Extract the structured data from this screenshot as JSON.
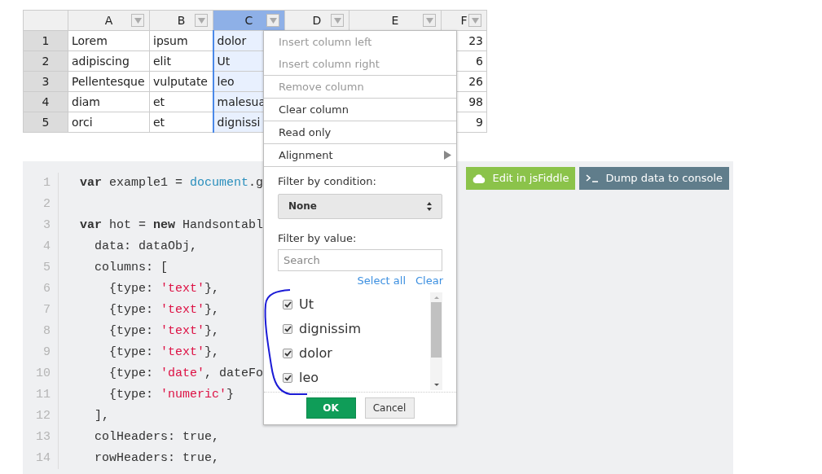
{
  "table": {
    "columns": [
      {
        "label": "A",
        "selected": false
      },
      {
        "label": "B",
        "selected": false
      },
      {
        "label": "C",
        "selected": true
      },
      {
        "label": "D",
        "selected": false
      },
      {
        "label": "E",
        "selected": false
      },
      {
        "label": "F",
        "selected": false
      }
    ],
    "rows": [
      {
        "header": "1",
        "a": "Lorem",
        "b": "ipsum",
        "c": "dolor",
        "f": "23"
      },
      {
        "header": "2",
        "a": "adipiscing",
        "b": "elit",
        "c": "Ut",
        "f": "6"
      },
      {
        "header": "3",
        "a": "Pellentesque",
        "b": "vulputate",
        "c": "leo",
        "f": "26"
      },
      {
        "header": "4",
        "a": "diam",
        "b": "et",
        "c": "malesua",
        "f": "98"
      },
      {
        "header": "5",
        "a": "orci",
        "b": "et",
        "c": "dignissi",
        "f": "9"
      }
    ]
  },
  "code": {
    "lines": [
      {
        "number": "1",
        "tokens": [
          {
            "kind": "keyword",
            "text": "var"
          },
          {
            "kind": "plain",
            "text": " example1 = "
          },
          {
            "kind": "property",
            "text": "document"
          },
          {
            "kind": "plain",
            "text": ".g"
          }
        ]
      },
      {
        "number": "2"
      },
      {
        "number": "3",
        "tokens": [
          {
            "kind": "keyword",
            "text": "var"
          },
          {
            "kind": "plain",
            "text": " hot = "
          },
          {
            "kind": "keyword",
            "text": "new"
          },
          {
            "kind": "plain",
            "text": " Handsontabl"
          }
        ]
      },
      {
        "number": "4",
        "tokens": [
          {
            "kind": "plain",
            "text": "  data: dataObj,"
          }
        ]
      },
      {
        "number": "5",
        "tokens": [
          {
            "kind": "plain",
            "text": "  columns: ["
          }
        ]
      },
      {
        "number": "6",
        "tokens": [
          {
            "kind": "plain",
            "text": "    {type: "
          },
          {
            "kind": "string",
            "text": "'text'"
          },
          {
            "kind": "plain",
            "text": "},"
          }
        ]
      },
      {
        "number": "7",
        "tokens": [
          {
            "kind": "plain",
            "text": "    {type: "
          },
          {
            "kind": "string",
            "text": "'text'"
          },
          {
            "kind": "plain",
            "text": "},"
          }
        ]
      },
      {
        "number": "8",
        "tokens": [
          {
            "kind": "plain",
            "text": "    {type: "
          },
          {
            "kind": "string",
            "text": "'text'"
          },
          {
            "kind": "plain",
            "text": "},"
          }
        ]
      },
      {
        "number": "9",
        "tokens": [
          {
            "kind": "plain",
            "text": "    {type: "
          },
          {
            "kind": "string",
            "text": "'text'"
          },
          {
            "kind": "plain",
            "text": "},"
          }
        ]
      },
      {
        "number": "10",
        "tokens": [
          {
            "kind": "plain",
            "text": "    {type: "
          },
          {
            "kind": "string",
            "text": "'date'"
          },
          {
            "kind": "plain",
            "text": ", dateFo"
          }
        ]
      },
      {
        "number": "11",
        "tokens": [
          {
            "kind": "plain",
            "text": "    {type: "
          },
          {
            "kind": "string",
            "text": "'numeric'"
          },
          {
            "kind": "plain",
            "text": "}"
          }
        ]
      },
      {
        "number": "12",
        "tokens": [
          {
            "kind": "plain",
            "text": "  ],"
          }
        ]
      },
      {
        "number": "13",
        "tokens": [
          {
            "kind": "plain",
            "text": "  colHeaders: true,"
          }
        ]
      },
      {
        "number": "14",
        "tokens": [
          {
            "kind": "plain",
            "text": "  rowHeaders: true,"
          }
        ]
      }
    ]
  },
  "code_buttons": [
    {
      "label": "Edit in jsFiddle",
      "kind": "jsfiddle"
    },
    {
      "label": "Dump data to console",
      "kind": "console"
    }
  ],
  "context_menu": {
    "groups": [
      [
        {
          "label": "Insert column left",
          "disabled": true,
          "kind": "item"
        },
        {
          "label": "Insert column right",
          "disabled": true,
          "kind": "item"
        }
      ],
      [
        {
          "label": "Remove column",
          "disabled": true,
          "kind": "item"
        }
      ],
      [
        {
          "label": "Clear column",
          "disabled": false,
          "kind": "item"
        }
      ],
      [
        {
          "label": "Read only",
          "disabled": false,
          "kind": "item"
        }
      ],
      [
        {
          "label": "Alignment",
          "disabled": false,
          "kind": "submenu"
        }
      ]
    ],
    "filter_condition": {
      "label": "Filter by condition:",
      "value": "None"
    },
    "filter_value": {
      "label": "Filter by value:",
      "placeholder": "Search",
      "select_all": "Select all",
      "clear": "Clear",
      "values": [
        {
          "label": "Ut",
          "checked": true
        },
        {
          "label": "dignissim",
          "checked": true
        },
        {
          "label": "dolor",
          "checked": true
        },
        {
          "label": "leo",
          "checked": true
        }
      ]
    },
    "buttons": [
      {
        "label": "OK",
        "kind": "primary"
      },
      {
        "label": "Cancel",
        "kind": "secondary"
      }
    ]
  }
}
